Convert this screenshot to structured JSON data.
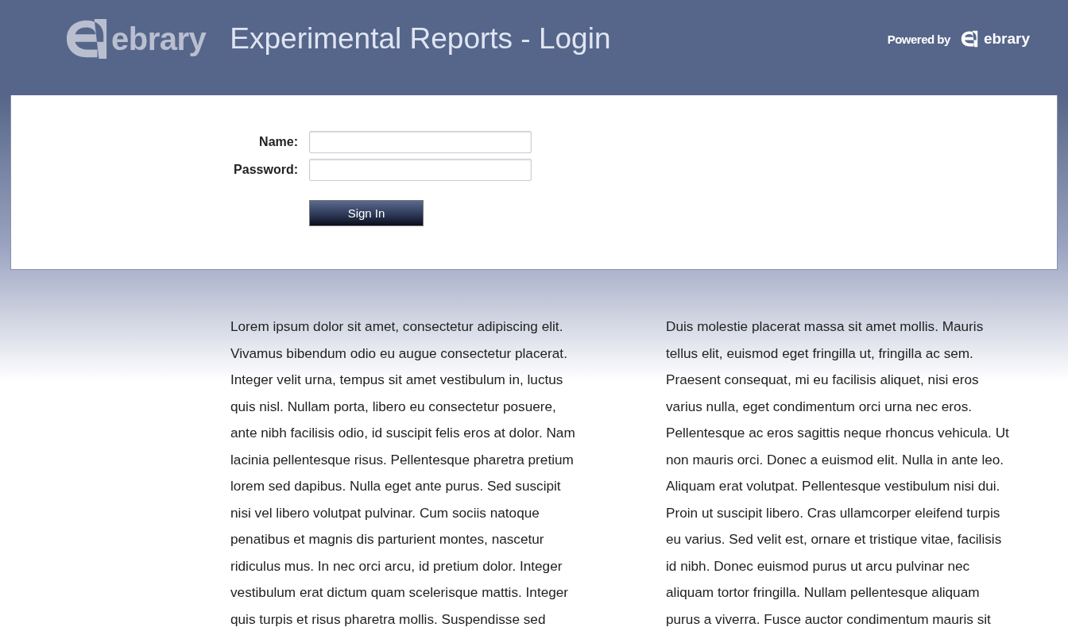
{
  "header": {
    "logo_text": "ebrary",
    "title": "Experimental Reports - Login",
    "powered_by": "Powered by",
    "powered_logo_text": "ebrary"
  },
  "login": {
    "fields": [
      {
        "label": "Name:"
      },
      {
        "label": "Password:"
      }
    ],
    "submit": "Sign In"
  },
  "columns": [
    {
      "lines": [
        "Lorem ipsum dolor sit amet, consectetur adipiscing elit.",
        "Vivamus bibendum odio eu augue consectetur placerat.",
        "Integer velit urna, tempus sit amet vestibulum in, luctus",
        "quis nisl. Nullam porta, libero eu consectetur posuere,",
        "ante nibh facilisis odio, id suscipit felis eros at dolor. Nam",
        "lacinia pellentesque risus. Pellentesque pharetra pretium",
        "lorem sed dapibus. Nulla eget ante purus. Sed suscipit",
        "nisi vel libero volutpat pulvinar. Cum sociis natoque",
        "penatibus et magnis dis parturient montes, nascetur",
        "ridiculus mus. In nec orci arcu, id pretium dolor. Integer",
        "vestibulum erat dictum quam scelerisque mattis. Integer",
        "quis turpis et risus pharetra mollis. Suspendisse sed"
      ]
    },
    {
      "lines": [
        "Duis molestie placerat massa sit amet mollis. Mauris",
        "tellus elit, euismod eget fringilla ut, fringilla ac sem.",
        "Praesent consequat, mi eu facilisis aliquet, nisi eros",
        "varius nulla, eget condimentum orci urna nec eros.",
        "Pellentesque ac eros sagittis neque rhoncus vehicula. Ut",
        "non mauris orci. Donec a euismod elit. Nulla in ante leo.",
        "Aliquam erat volutpat. Pellentesque vestibulum nisi dui.",
        "Proin ut suscipit libero. Cras ullamcorper eleifend turpis",
        "eu varius. Sed velit est, ornare et tristique vitae, facilisis",
        "id nibh. Donec euismod purus ut arcu pulvinar nec",
        "aliquam tortor fringilla. Nullam pellentesque aliquam",
        "purus a viverra. Fusce auctor condimentum mauris sit"
      ]
    }
  ]
}
